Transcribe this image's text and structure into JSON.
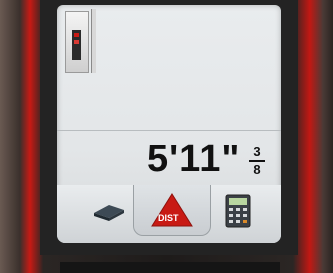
{
  "device": {
    "screen": {
      "status": {
        "battery_icon": "battery-icon"
      },
      "measurement": {
        "value": "5'11\"",
        "fraction_numerator": "3",
        "fraction_denominator": "8"
      },
      "toolbar": {
        "tabs": [
          {
            "name": "area",
            "icon": "area-icon"
          },
          {
            "name": "distance",
            "icon": "distance-triangle-icon",
            "label": "DIST",
            "selected": true
          },
          {
            "name": "calculator",
            "icon": "calculator-icon"
          }
        ]
      }
    }
  },
  "colors": {
    "accent_red": "#c81a14",
    "screen_bg": "#e6e9eb",
    "text": "#111111"
  }
}
